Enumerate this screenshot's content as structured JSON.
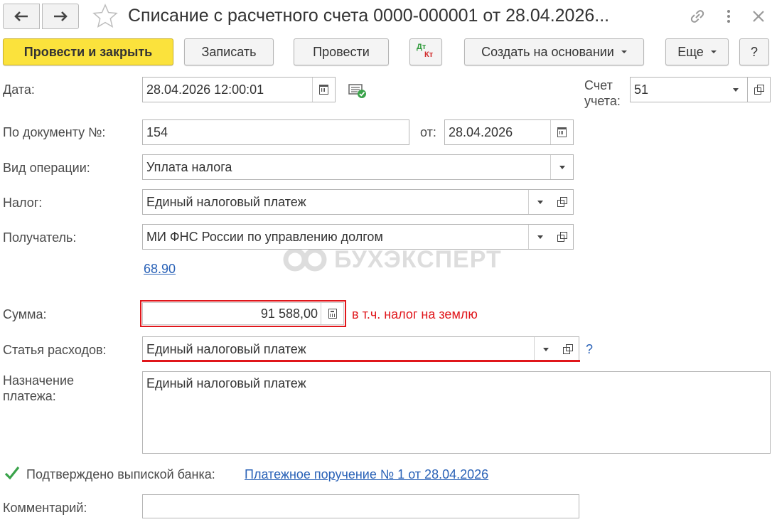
{
  "header": {
    "title": "Списание с расчетного счета 0000-000001 от 28.04.2026...",
    "icons": [
      "arrow-left-icon",
      "arrow-right-icon",
      "star-icon",
      "link-icon",
      "more-vertical-icon",
      "close-icon"
    ]
  },
  "toolbar": {
    "post_close_label": "Провести и закрыть",
    "save_label": "Записать",
    "post_label": "Провести",
    "dtkt_dt": "Дт",
    "dtkt_kt": "Кт",
    "create_based_label": "Создать на основании",
    "more_label": "Еще",
    "help_label": "?"
  },
  "form": {
    "date_label": "Дата:",
    "date_value": "28.04.2026 12:00:01",
    "account_label_1": "Счет",
    "account_label_2": "учета:",
    "account_value": "51",
    "doc_number_label": "По документу №:",
    "doc_number_value": "154",
    "doc_date_label": "от:",
    "doc_date_value": "28.04.2026",
    "operation_label": "Вид операции:",
    "operation_value": "Уплата налога",
    "tax_label": "Налог:",
    "tax_value": "Единый налоговый платеж",
    "recipient_label": "Получатель:",
    "recipient_value": "МИ ФНС России по управлению долгом",
    "account_link": "68.90",
    "sum_label": "Сумма:",
    "sum_value": "91 588,00",
    "sum_note": "в т.ч. налог на землю",
    "expense_label": "Статья расходов:",
    "expense_value": "Единый налоговый платеж",
    "expense_help": "?",
    "purpose_label_1": "Назначение",
    "purpose_label_2": "платежа:",
    "purpose_value": "Единый налоговый платеж",
    "confirmed_label": "Подтверждено выпиской банка:",
    "confirmed_checked": true,
    "payment_order_link": "Платежное поручение № 1 от 28.04.2026",
    "comment_label": "Комментарий:",
    "comment_value": ""
  },
  "watermark": "БУХЭКСПЕРТ",
  "colors": {
    "primary_button": "#fbe23c",
    "highlight": "#e0161b",
    "link": "#2a62b7",
    "check": "#3aa34a"
  }
}
